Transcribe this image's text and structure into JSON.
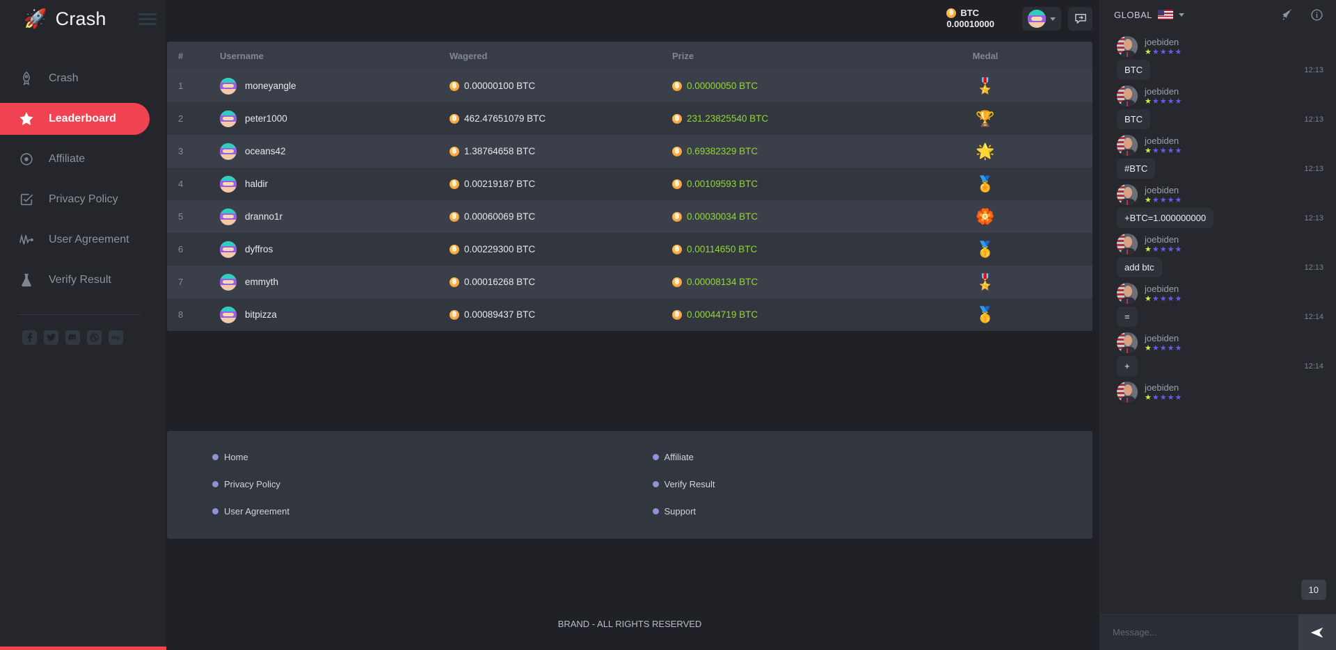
{
  "brand": {
    "name": "Crash",
    "rocket_icon": "rocket-icon",
    "menu_icon": "hamburger-menu-icon"
  },
  "sidebar": {
    "items": [
      {
        "label": "Crash",
        "icon": "rocket-icon",
        "active": false
      },
      {
        "label": "Leaderboard",
        "icon": "star-icon",
        "active": true
      },
      {
        "label": "Affiliate",
        "icon": "target-icon",
        "active": false
      },
      {
        "label": "Privacy Policy",
        "icon": "checkbox-icon",
        "active": false
      },
      {
        "label": "User Agreement",
        "icon": "pulse-icon",
        "active": false
      },
      {
        "label": "Verify Result",
        "icon": "flask-icon",
        "active": false
      }
    ],
    "socials": [
      {
        "name": "facebook-icon",
        "glyph": "f"
      },
      {
        "name": "twitter-icon",
        "glyph": "t"
      },
      {
        "name": "discord-icon",
        "glyph": "d"
      },
      {
        "name": "dribbble-icon",
        "glyph": "o"
      },
      {
        "name": "mp-icon",
        "glyph": "mp"
      }
    ]
  },
  "topbar": {
    "currency": "BTC",
    "balance": "0.00010000",
    "coin_symbol": "Ƀ",
    "avatar_icon": "user-avatar",
    "dropdown_icon": "chevron-down-icon",
    "bell_icon": "notification-bell-icon",
    "chat_toggle_icon": "chat-toggle-icon"
  },
  "table": {
    "columns": [
      "#",
      "Username",
      "Wagered",
      "Prize",
      "Medal"
    ],
    "rows": [
      {
        "rank": "1",
        "username": "moneyangle",
        "wagered": "0.00000100 BTC",
        "prize": "0.00000050 BTC",
        "medal": "🎖️",
        "medal_name": "rosette-medal-icon"
      },
      {
        "rank": "2",
        "username": "peter1000",
        "wagered": "462.47651079 BTC",
        "prize": "231.23825540 BTC",
        "medal": "🏆",
        "medal_name": "trophy-icon"
      },
      {
        "rank": "3",
        "username": "oceans42",
        "wagered": "1.38764658 BTC",
        "prize": "0.69382329 BTC",
        "medal": "🌟",
        "medal_name": "star-trophy-icon"
      },
      {
        "rank": "4",
        "username": "haldir",
        "wagered": "0.00219187 BTC",
        "prize": "0.00109593 BTC",
        "medal": "🏅",
        "medal_name": "laurel-medal-icon"
      },
      {
        "rank": "5",
        "username": "dranno1r",
        "wagered": "0.00060069 BTC",
        "prize": "0.00030034 BTC",
        "medal": "🏵️",
        "medal_name": "pin-trophy-icon"
      },
      {
        "rank": "6",
        "username": "dyffros",
        "wagered": "0.00229300 BTC",
        "prize": "0.00114650 BTC",
        "medal": "🥇",
        "medal_name": "gold-medal-icon"
      },
      {
        "rank": "7",
        "username": "emmyth",
        "wagered": "0.00016268 BTC",
        "prize": "0.00008134 BTC",
        "medal": "🎖️",
        "medal_name": "military-medal-icon"
      },
      {
        "rank": "8",
        "username": "bitpizza",
        "wagered": "0.00089437 BTC",
        "prize": "0.00044719 BTC",
        "medal": "🥇",
        "medal_name": "ribbon-medal-icon"
      }
    ]
  },
  "footer": {
    "column_left": [
      "Home",
      "Privacy Policy",
      "User Agreement"
    ],
    "column_right": [
      "Affiliate",
      "Verify Result",
      "Support"
    ],
    "copyright": "BRAND - ALL RIGHTS RESERVED"
  },
  "chat": {
    "scope": "GLOBAL",
    "flag_icon": "us-flag-icon",
    "dropdown_icon": "chevron-down-icon",
    "rocket_icon": "rocket-icon",
    "info_icon": "info-icon",
    "unread_badge": "10",
    "input_placeholder": "Message...",
    "send_icon": "send-icon",
    "messages": [
      {
        "user": "joebiden",
        "stars": 5,
        "text": "BTC",
        "time": "12:13"
      },
      {
        "user": "joebiden",
        "stars": 5,
        "text": "BTC",
        "time": "12:13"
      },
      {
        "user": "joebiden",
        "stars": 5,
        "text": "#BTC",
        "time": "12:13"
      },
      {
        "user": "joebiden",
        "stars": 5,
        "text": "+BTC=1.000000000",
        "time": "12:13"
      },
      {
        "user": "joebiden",
        "stars": 5,
        "text": "add btc",
        "time": "12:13"
      },
      {
        "user": "joebiden",
        "stars": 5,
        "text": "=",
        "time": "12:14"
      },
      {
        "user": "joebiden",
        "stars": 5,
        "text": "+",
        "time": "12:14"
      },
      {
        "user": "joebiden",
        "stars": 5,
        "text": "",
        "time": ""
      }
    ]
  },
  "colors": {
    "accent_red": "#ef4352",
    "prize_green": "#94d82d",
    "bg": "#1f2127",
    "panel": "#32363f",
    "row_alt": "#3a3f49",
    "sidebar": "#24262c",
    "chat_bg": "#26282e"
  }
}
